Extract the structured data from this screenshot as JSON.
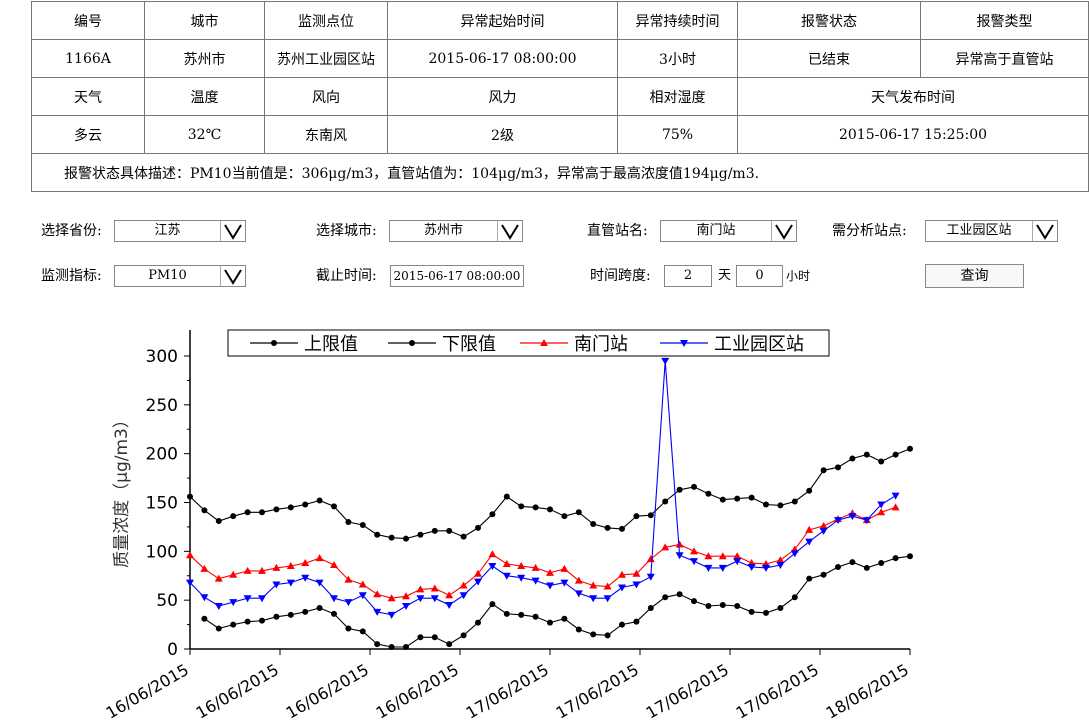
{
  "info_table": {
    "row1": [
      "编号",
      "城市",
      "监测点位",
      "异常起始时间",
      "异常持续时间",
      "报警状态",
      "报警类型"
    ],
    "row2": [
      "1166A",
      "苏州市",
      "苏州工业园区站",
      "2015-06-17  08:00:00",
      "3小时",
      "已结束",
      "异常高于直管站"
    ],
    "row3": [
      "天气",
      "温度",
      "风向",
      "风力",
      "相对湿度",
      "天气发布时间"
    ],
    "row4": [
      "多云",
      "32℃",
      "东南风",
      "2级",
      "75%",
      "2015-06-17  15:25:00"
    ],
    "description": "报警状态具体描述：PM10当前值是：306μg/m3，直管站值为：104μg/m3，异常高于最高浓度值194μg/m3."
  },
  "controls": {
    "province_label": "选择省份:",
    "province_value": "江苏",
    "city_label": "选择城市:",
    "city_value": "苏州市",
    "station_label": "直管站名:",
    "station_value": "南门站",
    "analysis_label": "需分析站点:",
    "analysis_value": "工业园区站",
    "indicator_label": "监测指标:",
    "indicator_value": "PM10",
    "end_time_label": "截止时间:",
    "end_time_value": "2015-06-17  08:00:00",
    "span_label": "时间跨度:",
    "span_days": "2",
    "span_days_unit": "天",
    "span_hours": "0",
    "span_hours_unit": "小时",
    "query_button": "查询"
  },
  "colors": {
    "upper": "#000000",
    "lower": "#000000",
    "nanmen": "#ff0000",
    "park": "#0000ff"
  },
  "chart_data": {
    "type": "line",
    "ylabel": "质量浓度（μg/m3）",
    "ylim": [
      0,
      300
    ],
    "yticks": [
      0,
      50,
      100,
      150,
      200,
      250,
      300
    ],
    "xticks": [
      "16/06/2015",
      "16/06/2015",
      "16/06/2015",
      "16/06/2015",
      "17/06/2015",
      "17/06/2015",
      "17/06/2015",
      "17/06/2015",
      "18/06/2015"
    ],
    "legend_position": "top",
    "series": [
      {
        "name": "上限值",
        "marker": "circle",
        "color": "#000000",
        "values": [
          156,
          142,
          131,
          136,
          140,
          140,
          143,
          145,
          148,
          152,
          146,
          130,
          127,
          117,
          114,
          113,
          117,
          121,
          121,
          115,
          124,
          138,
          156,
          146,
          145,
          143,
          136,
          140,
          128,
          124,
          123,
          136,
          137,
          151,
          163,
          166,
          159,
          153,
          154,
          155,
          148,
          147,
          151,
          162,
          183,
          186,
          195,
          199,
          192,
          199,
          205
        ]
      },
      {
        "name": "下限值",
        "marker": "circle",
        "color": "#000000",
        "values": [
          null,
          31,
          21,
          25,
          28,
          29,
          33,
          35,
          38,
          42,
          36,
          21,
          18,
          5,
          2,
          2,
          12,
          12,
          5,
          14,
          27,
          46,
          36,
          35,
          33,
          27,
          31,
          20,
          15,
          14,
          25,
          28,
          42,
          53,
          56,
          49,
          44,
          45,
          44,
          38,
          37,
          42,
          53,
          72,
          76,
          84,
          89,
          83,
          88,
          93,
          95
        ]
      },
      {
        "name": "南门站",
        "marker": "triangle-up",
        "color": "#ff0000",
        "values": [
          96,
          82,
          72,
          76,
          80,
          80,
          83,
          85,
          88,
          93,
          86,
          71,
          66,
          56,
          52,
          54,
          61,
          62,
          55,
          65,
          77,
          97,
          87,
          85,
          83,
          78,
          82,
          70,
          65,
          64,
          76,
          77,
          92,
          104,
          107,
          100,
          95,
          95,
          95,
          88,
          87,
          91,
          102,
          122,
          126,
          133,
          139,
          132,
          140,
          145
        ]
      },
      {
        "name": "工业园区站",
        "marker": "triangle-down",
        "color": "#0000ff",
        "values": [
          68,
          53,
          44,
          48,
          52,
          52,
          66,
          68,
          73,
          68,
          52,
          48,
          55,
          38,
          35,
          44,
          52,
          52,
          45,
          55,
          69,
          85,
          75,
          73,
          70,
          65,
          68,
          57,
          52,
          52,
          63,
          66,
          74,
          295,
          96,
          90,
          83,
          83,
          90,
          84,
          83,
          86,
          98,
          110,
          121,
          132,
          136,
          132,
          148,
          157
        ]
      }
    ]
  }
}
